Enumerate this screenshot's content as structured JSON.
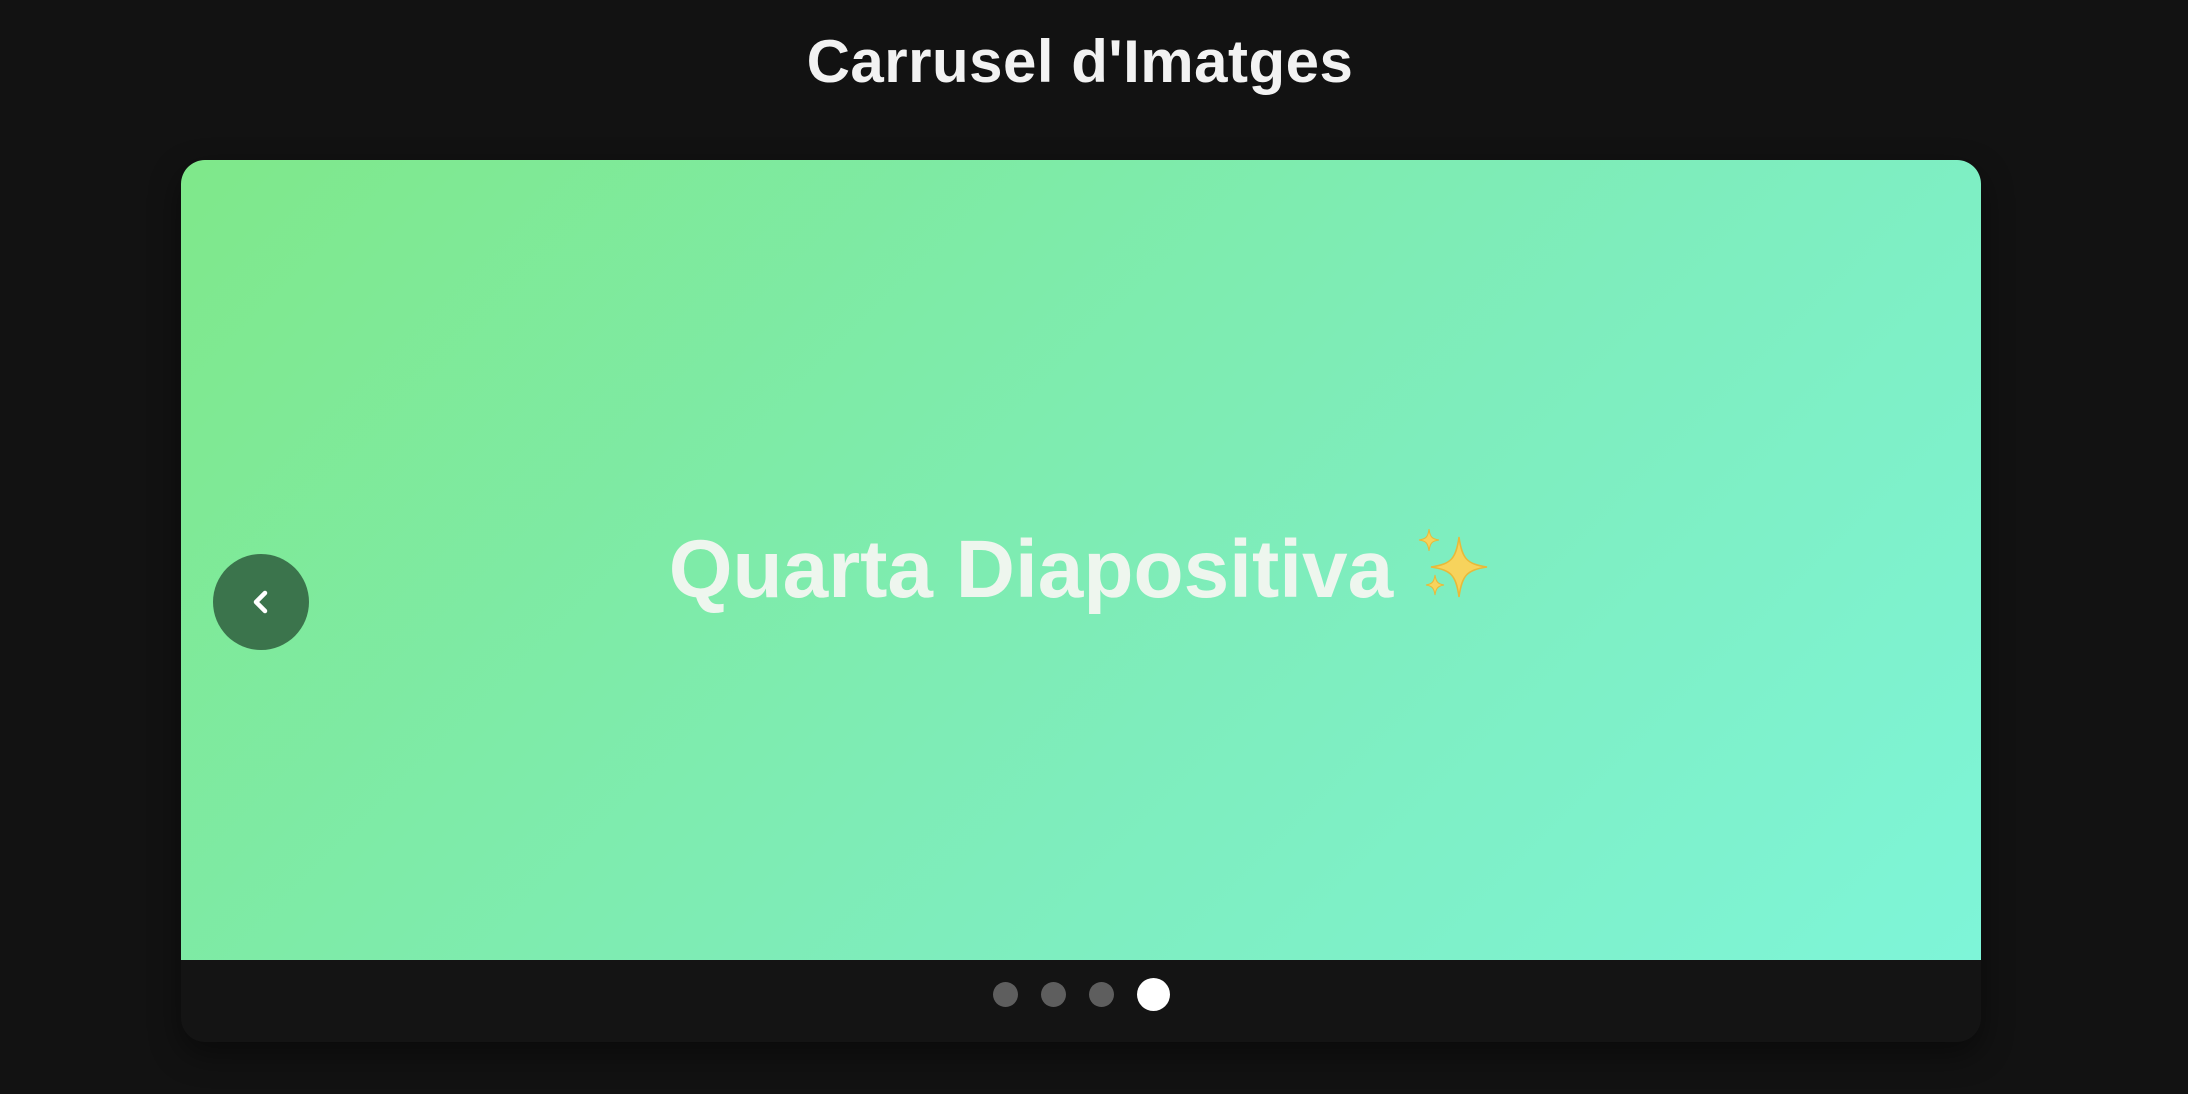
{
  "page": {
    "title": "Carrusel d'Imatges"
  },
  "carousel": {
    "current_slide": {
      "title": "Quarta Diapositiva",
      "emoji_icon": "sparkles-icon",
      "gradient": [
        "#7fe88a",
        "#7ef5d8"
      ]
    },
    "prev_icon": "chevron-left-icon",
    "prev_button_color": "#3b744c",
    "active_index": 4,
    "slide_count": 4,
    "dot_color": "#5e5e5e",
    "dot_active_color": "#ffffff"
  }
}
